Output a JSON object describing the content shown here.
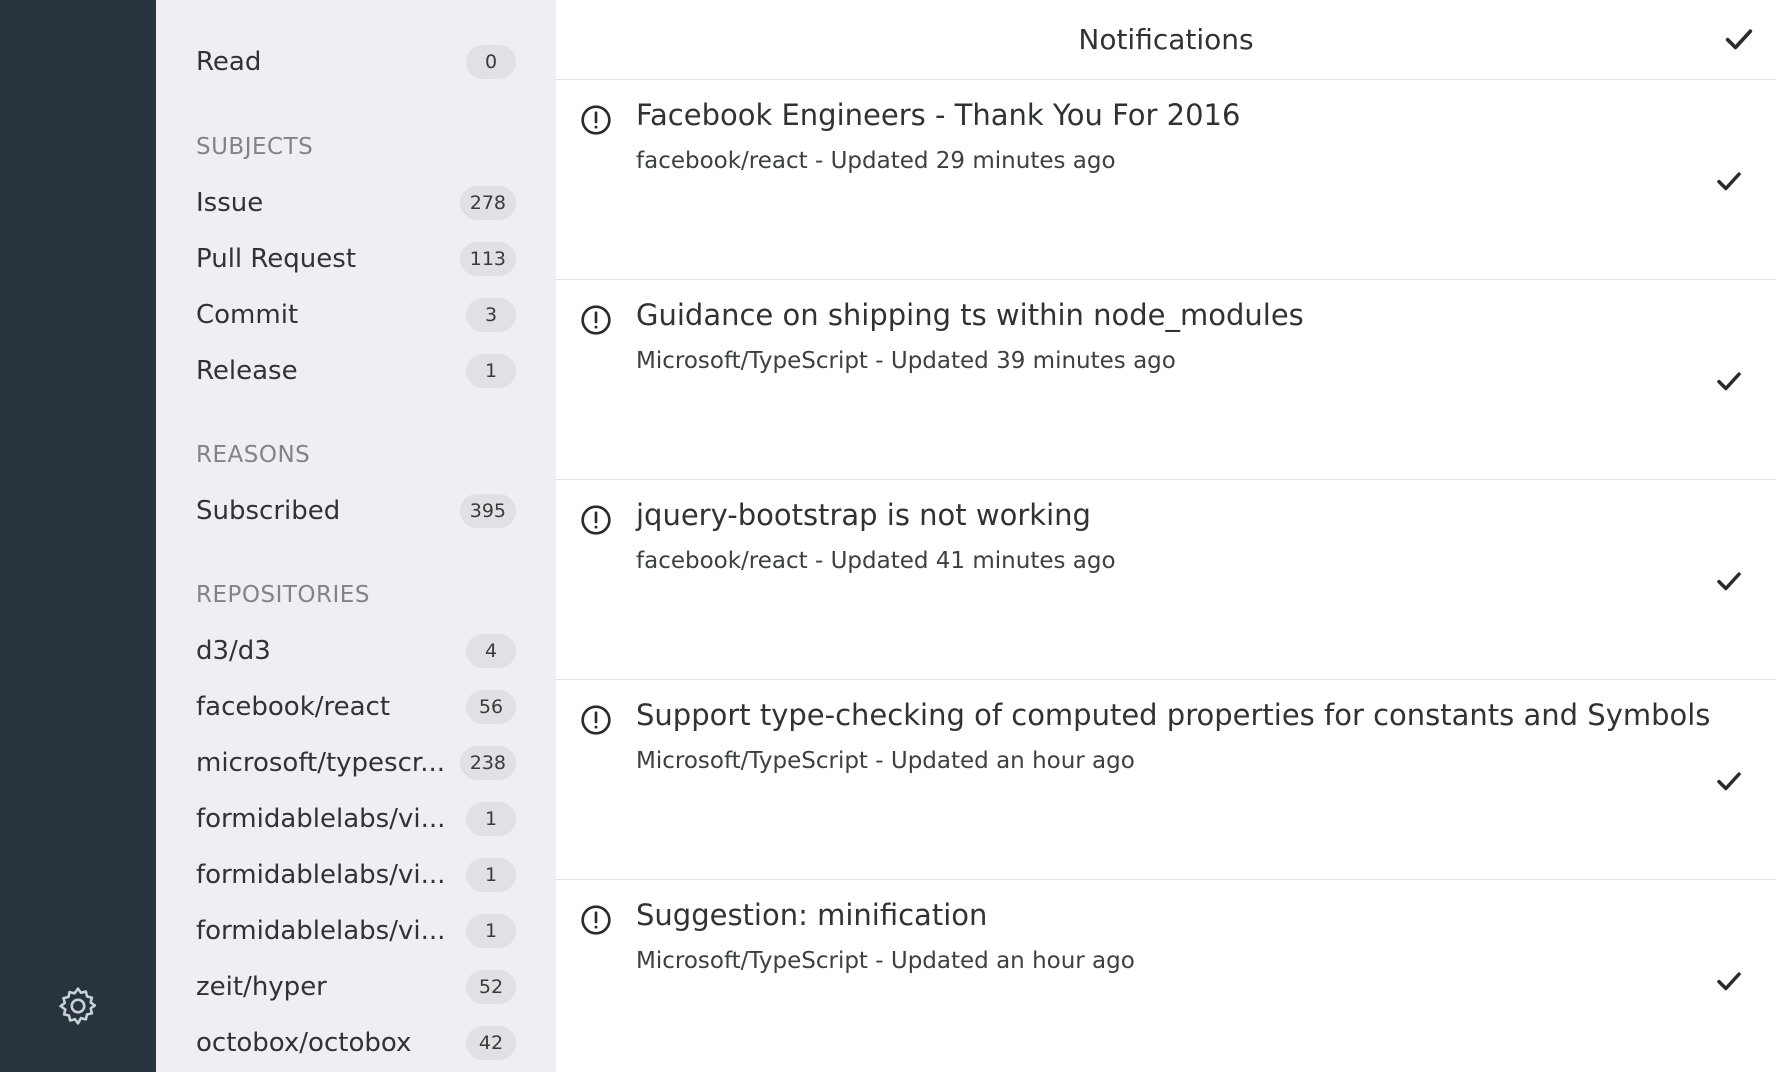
{
  "colors": {
    "rail": "#27343d",
    "sidebar_bg": "#eeeef3",
    "badge_bg": "#e0e0e5",
    "heading": "#80848a"
  },
  "rail": {
    "settings_icon": "gear-icon"
  },
  "sidebar": {
    "read": {
      "label": "Read",
      "count": "0"
    },
    "subjects": {
      "heading": "SUBJECTS",
      "items": [
        {
          "label": "Issue",
          "count": "278"
        },
        {
          "label": "Pull Request",
          "count": "113"
        },
        {
          "label": "Commit",
          "count": "3"
        },
        {
          "label": "Release",
          "count": "1"
        }
      ]
    },
    "reasons": {
      "heading": "REASONS",
      "items": [
        {
          "label": "Subscribed",
          "count": "395"
        }
      ]
    },
    "repositories": {
      "heading": "REPOSITORIES",
      "items": [
        {
          "label": "d3/d3",
          "count": "4"
        },
        {
          "label": "facebook/react",
          "count": "56"
        },
        {
          "label": "microsoft/typescr...",
          "count": "238"
        },
        {
          "label": "formidablelabs/vi...",
          "count": "1"
        },
        {
          "label": "formidablelabs/vi...",
          "count": "1"
        },
        {
          "label": "formidablelabs/vi...",
          "count": "1"
        },
        {
          "label": "zeit/hyper",
          "count": "52"
        },
        {
          "label": "octobox/octobox",
          "count": "42"
        }
      ]
    }
  },
  "main": {
    "title": "Notifications",
    "notifications": [
      {
        "title": "Facebook Engineers - Thank You For 2016",
        "meta": "facebook/react - Updated 29 minutes ago",
        "icon": "issue-icon"
      },
      {
        "title": "Guidance on shipping ts within node_modules",
        "meta": "Microsoft/TypeScript - Updated 39 minutes ago",
        "icon": "issue-icon"
      },
      {
        "title": "jquery-bootstrap is not working",
        "meta": "facebook/react - Updated 41 minutes ago",
        "icon": "issue-icon"
      },
      {
        "title": "Support type-checking of computed properties for constants and Symbols",
        "meta": "Microsoft/TypeScript - Updated an hour ago",
        "icon": "issue-icon"
      },
      {
        "title": "Suggestion: minification",
        "meta": "Microsoft/TypeScript - Updated an hour ago",
        "icon": "issue-icon"
      }
    ]
  }
}
